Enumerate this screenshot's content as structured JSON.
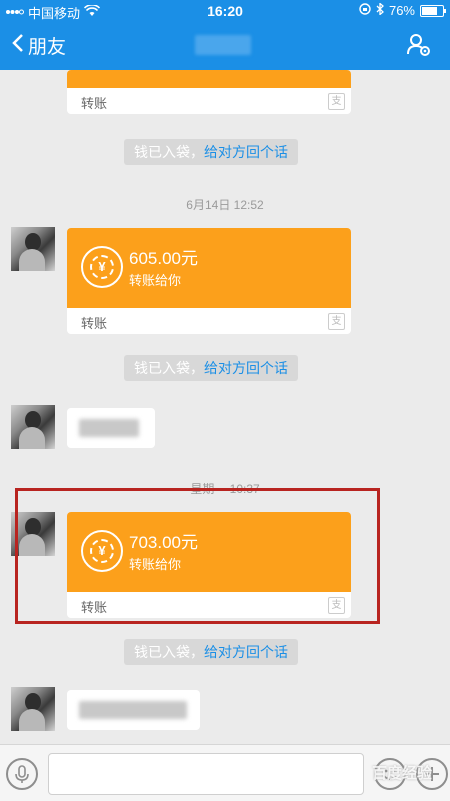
{
  "status_bar": {
    "carrier": "中国移动",
    "time": "16:20",
    "battery": "76%",
    "battery_level": 0.76
  },
  "nav": {
    "back_label": "朋友"
  },
  "messages": {
    "transfer_label": "转账",
    "sys_money_received": "钱已入袋，",
    "sys_reply_link": "给对方回个话",
    "timestamp_1": "6月14日 12:52",
    "timestamp_2": "星期一 10:37",
    "transfer_1": {
      "amount": "605.00元",
      "desc": "转账给你"
    },
    "transfer_2": {
      "amount": "703.00元",
      "desc": "转账给你"
    }
  },
  "watermark": "百度经验",
  "colors": {
    "header_blue": "#1b8fe6",
    "transfer_orange": "#fca01b",
    "highlight_red": "#b82420"
  }
}
